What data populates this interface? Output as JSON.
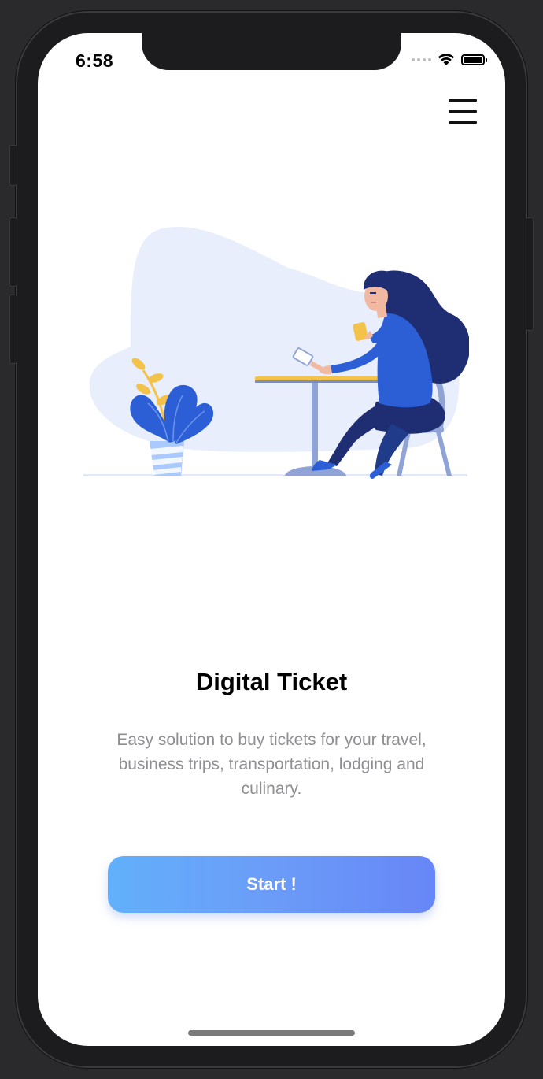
{
  "status_bar": {
    "time": "6:58",
    "wifi_icon": "wifi-icon",
    "battery_icon": "battery-icon"
  },
  "header": {
    "menu_icon": "hamburger-menu-icon"
  },
  "illustration": {
    "description_icon": "woman-at-cafe-table-illustration"
  },
  "onboarding": {
    "title": "Digital Ticket",
    "description": "Easy solution to buy tickets for your travel, business trips, transportation, lodging and culinary.",
    "start_label": "Start !"
  },
  "colors": {
    "button_gradient_start": "#62b0fb",
    "button_gradient_end": "#6786f7",
    "illustration_blue": "#2c5fd6",
    "illustration_navy": "#1f2d72",
    "illustration_yellow": "#f3c24a",
    "blob_background": "#e8eefb"
  }
}
